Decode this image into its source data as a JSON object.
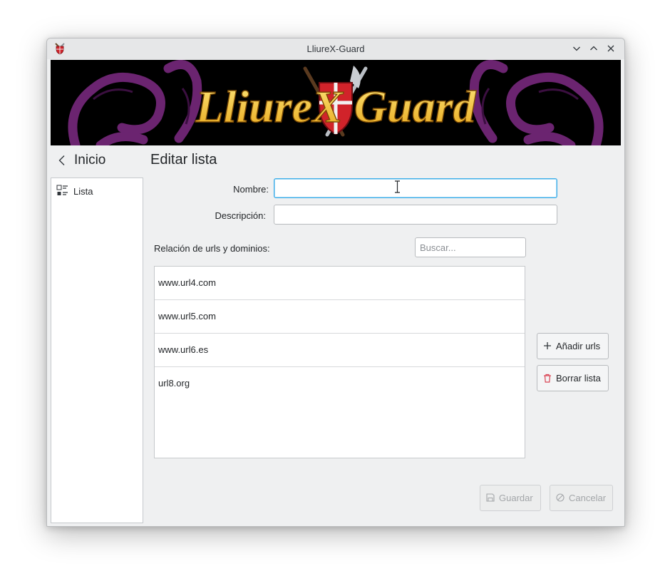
{
  "window": {
    "title": "LliureX-Guard",
    "controls": [
      "minimize",
      "maximize",
      "close"
    ]
  },
  "banner": {
    "text": "LliureX Guard",
    "colors": {
      "background": "#000000",
      "text": "#f7c531",
      "dragons": "#6b2470",
      "shield": "#d1232a"
    }
  },
  "nav": {
    "back_label": "Inicio"
  },
  "sidebar": {
    "items": [
      {
        "label": "Lista",
        "icon": "list-icon"
      }
    ]
  },
  "main": {
    "title": "Editar lista",
    "fields": {
      "name_label": "Nombre:",
      "name_value": "",
      "description_label": "Descripción:",
      "description_value": ""
    },
    "urls_label": "Relación de urls y dominios:",
    "search_placeholder": "Buscar...",
    "urls": [
      "www.url4.com",
      "www.url5.com",
      "www.url6.es",
      "url8.org"
    ],
    "add_button": "Añadir urls",
    "delete_button": "Borrar lista",
    "save_button": "Guardar",
    "cancel_button": "Cancelar"
  },
  "colors": {
    "accent": "#3daee9",
    "delete_red": "#da4453"
  }
}
